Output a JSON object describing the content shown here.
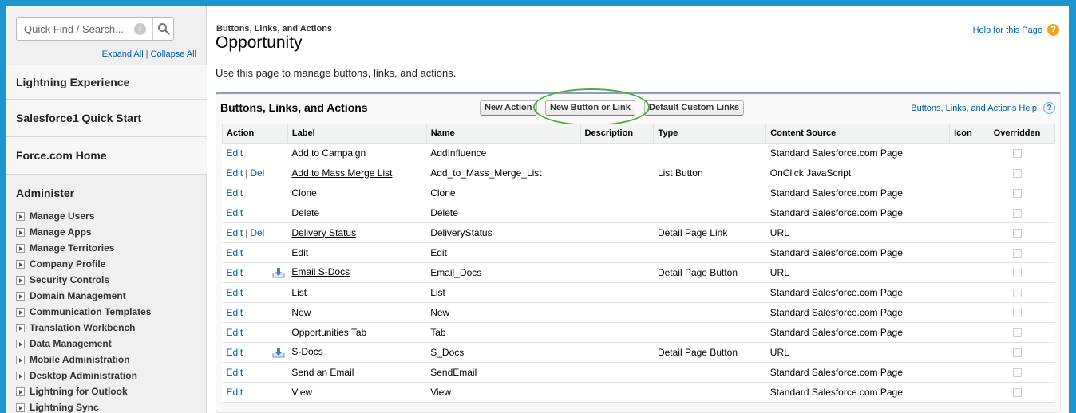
{
  "sidebar": {
    "search": {
      "placeholder": "Quick Find / Search..."
    },
    "expand_all": "Expand All",
    "separator": "|",
    "collapse_all": "Collapse All",
    "sections": [
      "Lightning Experience",
      "Salesforce1 Quick Start",
      "Force.com Home"
    ],
    "administer": {
      "title": "Administer",
      "items": [
        "Manage Users",
        "Manage Apps",
        "Manage Territories",
        "Company Profile",
        "Security Controls",
        "Domain Management",
        "Communication Templates",
        "Translation Workbench",
        "Data Management",
        "Mobile Administration",
        "Desktop Administration",
        "Lightning for Outlook",
        "Lightning Sync"
      ]
    }
  },
  "header": {
    "breadcrumb": "Buttons, Links, and Actions",
    "title": "Opportunity",
    "help_link": "Help for this Page",
    "description": "Use this page to manage buttons, links, and actions."
  },
  "panel": {
    "title": "Buttons, Links, and Actions",
    "buttons": {
      "new_action": "New Action",
      "new_button_or_link": "New Button or Link",
      "default_custom_links": "Default Custom Links"
    },
    "help_link": "Buttons, Links, and Actions Help",
    "table": {
      "headers": [
        "Action",
        "Label",
        "Name",
        "Description",
        "Type",
        "Content Source",
        "Icon",
        "Overridden"
      ],
      "edit_label": "Edit",
      "del_label": "Del",
      "pipe": "|",
      "rows": [
        {
          "del": false,
          "label": "Add to Campaign",
          "link": false,
          "doc_icon": false,
          "name": "AddInfluence",
          "description": "",
          "type": "",
          "source": "Standard Salesforce.com Page"
        },
        {
          "del": true,
          "label": "Add to Mass Merge List",
          "link": true,
          "doc_icon": false,
          "name": "Add_to_Mass_Merge_List",
          "description": "",
          "type": "List Button",
          "source": "OnClick JavaScript"
        },
        {
          "del": false,
          "label": "Clone",
          "link": false,
          "doc_icon": false,
          "name": "Clone",
          "description": "",
          "type": "",
          "source": "Standard Salesforce.com Page"
        },
        {
          "del": false,
          "label": "Delete",
          "link": false,
          "doc_icon": false,
          "name": "Delete",
          "description": "",
          "type": "",
          "source": "Standard Salesforce.com Page"
        },
        {
          "del": true,
          "label": "Delivery Status",
          "link": true,
          "doc_icon": false,
          "name": "DeliveryStatus",
          "description": "",
          "type": "Detail Page Link",
          "source": "URL"
        },
        {
          "del": false,
          "label": "Edit",
          "link": false,
          "doc_icon": false,
          "name": "Edit",
          "description": "",
          "type": "",
          "source": "Standard Salesforce.com Page"
        },
        {
          "del": false,
          "label": "Email S-Docs",
          "link": true,
          "doc_icon": true,
          "name": "Email_Docs",
          "description": "",
          "type": "Detail Page Button",
          "source": "URL"
        },
        {
          "del": false,
          "label": "List",
          "link": false,
          "doc_icon": false,
          "name": "List",
          "description": "",
          "type": "",
          "source": "Standard Salesforce.com Page"
        },
        {
          "del": false,
          "label": "New",
          "link": false,
          "doc_icon": false,
          "name": "New",
          "description": "",
          "type": "",
          "source": "Standard Salesforce.com Page"
        },
        {
          "del": false,
          "label": "Opportunities Tab",
          "link": false,
          "doc_icon": false,
          "name": "Tab",
          "description": "",
          "type": "",
          "source": "Standard Salesforce.com Page"
        },
        {
          "del": false,
          "label": "S-Docs",
          "link": true,
          "doc_icon": true,
          "name": "S_Docs",
          "description": "",
          "type": "Detail Page Button",
          "source": "URL"
        },
        {
          "del": false,
          "label": "Send an Email",
          "link": false,
          "doc_icon": false,
          "name": "SendEmail",
          "description": "",
          "type": "",
          "source": "Standard Salesforce.com Page"
        },
        {
          "del": false,
          "label": "View",
          "link": false,
          "doc_icon": false,
          "name": "View",
          "description": "",
          "type": "",
          "source": "Standard Salesforce.com Page"
        }
      ]
    }
  },
  "colors": {
    "frame": "#1b96d1",
    "link": "#015ba7",
    "highlight": "#5aa544",
    "panel_border": "#8a9ebe"
  }
}
